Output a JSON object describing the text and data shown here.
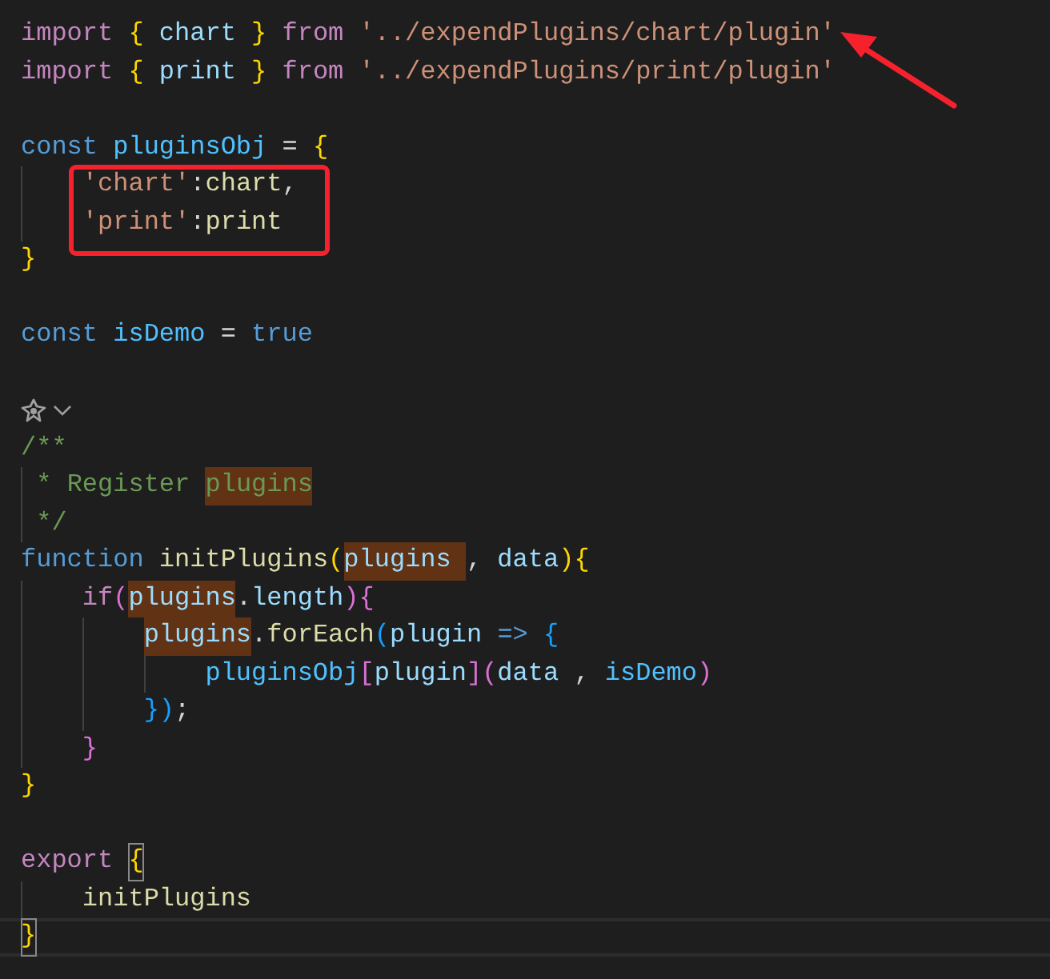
{
  "editor": {
    "lines": [
      {
        "kind": "code",
        "current": false,
        "tokens": [
          {
            "text": "import ",
            "kind": "keyword"
          },
          {
            "text": "{ ",
            "kind": "bracket1"
          },
          {
            "text": "chart ",
            "kind": "variable"
          },
          {
            "text": "} ",
            "kind": "bracket1"
          },
          {
            "text": "from ",
            "kind": "keyword"
          },
          {
            "text": "'../expendPlugins/chart/plugin'",
            "kind": "string"
          }
        ]
      },
      {
        "kind": "code",
        "current": false,
        "tokens": [
          {
            "text": "import ",
            "kind": "keyword"
          },
          {
            "text": "{ ",
            "kind": "bracket1"
          },
          {
            "text": "print ",
            "kind": "variable"
          },
          {
            "text": "} ",
            "kind": "bracket1"
          },
          {
            "text": "from ",
            "kind": "keyword"
          },
          {
            "text": "'../expendPlugins/print/plugin'",
            "kind": "string"
          }
        ]
      },
      {
        "kind": "blank"
      },
      {
        "kind": "code",
        "current": false,
        "tokens": [
          {
            "text": "const ",
            "kind": "storage"
          },
          {
            "text": "pluginsObj",
            "kind": "constant"
          },
          {
            "text": " = ",
            "kind": "plain"
          },
          {
            "text": "{",
            "kind": "bracket1"
          }
        ]
      },
      {
        "kind": "code",
        "current": false,
        "tokens": [
          {
            "text": "    'chart'",
            "kind": "string"
          },
          {
            "text": ":",
            "kind": "plain"
          },
          {
            "text": "chart",
            "kind": "value"
          },
          {
            "text": ",",
            "kind": "plain"
          }
        ]
      },
      {
        "kind": "code",
        "current": false,
        "tokens": [
          {
            "text": "    'print'",
            "kind": "string"
          },
          {
            "text": ":",
            "kind": "plain"
          },
          {
            "text": "print",
            "kind": "value"
          }
        ]
      },
      {
        "kind": "code",
        "current": false,
        "tokens": [
          {
            "text": "}",
            "kind": "bracket1"
          }
        ]
      },
      {
        "kind": "blank"
      },
      {
        "kind": "code",
        "current": false,
        "tokens": [
          {
            "text": "const ",
            "kind": "storage"
          },
          {
            "text": "isDemo",
            "kind": "constant"
          },
          {
            "text": " = ",
            "kind": "plain"
          },
          {
            "text": "true",
            "kind": "storage"
          }
        ]
      },
      {
        "kind": "blank"
      },
      {
        "kind": "codelens"
      },
      {
        "kind": "code",
        "current": false,
        "tokens": [
          {
            "text": "/**",
            "kind": "comment"
          }
        ]
      },
      {
        "kind": "code",
        "current": false,
        "tokens": [
          {
            "text": " * Register ",
            "kind": "comment"
          },
          {
            "text": "plugins",
            "kind": "comment",
            "word_highlight": true
          }
        ]
      },
      {
        "kind": "code",
        "current": false,
        "tokens": [
          {
            "text": " */",
            "kind": "comment"
          }
        ]
      },
      {
        "kind": "code",
        "current": false,
        "tokens": [
          {
            "text": "function ",
            "kind": "storage"
          },
          {
            "text": "initPlugins",
            "kind": "function"
          },
          {
            "text": "(",
            "kind": "bracket1"
          },
          {
            "text": "plugins ",
            "kind": "variable",
            "word_highlight": true
          },
          {
            "text": ", ",
            "kind": "plain"
          },
          {
            "text": "data",
            "kind": "variable"
          },
          {
            "text": ")",
            "kind": "bracket1"
          },
          {
            "text": "{",
            "kind": "bracket1"
          }
        ]
      },
      {
        "kind": "code",
        "current": false,
        "tokens": [
          {
            "text": "    if",
            "kind": "keyword"
          },
          {
            "text": "(",
            "kind": "bracket2"
          },
          {
            "text": "plugins",
            "kind": "variable",
            "word_highlight": true
          },
          {
            "text": ".",
            "kind": "plain"
          },
          {
            "text": "length",
            "kind": "variable"
          },
          {
            "text": ")",
            "kind": "bracket2"
          },
          {
            "text": "{",
            "kind": "bracket2"
          }
        ]
      },
      {
        "kind": "code",
        "current": false,
        "tokens": [
          {
            "text": "        plugins",
            "kind": "variable",
            "word_highlight": true
          },
          {
            "text": ".",
            "kind": "plain"
          },
          {
            "text": "forEach",
            "kind": "function"
          },
          {
            "text": "(",
            "kind": "bracket3"
          },
          {
            "text": "plugin ",
            "kind": "variable"
          },
          {
            "text": "=> ",
            "kind": "storage"
          },
          {
            "text": "{",
            "kind": "bracket3"
          }
        ]
      },
      {
        "kind": "code",
        "current": false,
        "tokens": [
          {
            "text": "            pluginsObj",
            "kind": "constant"
          },
          {
            "text": "[",
            "kind": "bracket2"
          },
          {
            "text": "plugin",
            "kind": "variable"
          },
          {
            "text": "]",
            "kind": "bracket2"
          },
          {
            "text": "(",
            "kind": "bracket2"
          },
          {
            "text": "data ",
            "kind": "variable"
          },
          {
            "text": ", ",
            "kind": "plain"
          },
          {
            "text": "isDemo",
            "kind": "constant"
          },
          {
            "text": ")",
            "kind": "bracket2"
          }
        ]
      },
      {
        "kind": "code",
        "current": false,
        "tokens": [
          {
            "text": "        }",
            "kind": "bracket3"
          },
          {
            "text": ")",
            "kind": "bracket3"
          },
          {
            "text": ";",
            "kind": "plain"
          }
        ]
      },
      {
        "kind": "code",
        "current": false,
        "tokens": [
          {
            "text": "    }",
            "kind": "bracket2"
          }
        ]
      },
      {
        "kind": "code",
        "current": false,
        "tokens": [
          {
            "text": "}",
            "kind": "bracket1"
          }
        ]
      },
      {
        "kind": "blank"
      },
      {
        "kind": "code",
        "current": false,
        "tokens": [
          {
            "text": "export ",
            "kind": "keyword"
          },
          {
            "text": "{",
            "kind": "bracket1",
            "bracket_match": true
          }
        ]
      },
      {
        "kind": "code",
        "current": false,
        "tokens": [
          {
            "text": "    initPlugins",
            "kind": "value"
          }
        ]
      },
      {
        "kind": "code",
        "current": true,
        "tokens": [
          {
            "text": "}",
            "kind": "bracket1",
            "bracket_match": true
          }
        ]
      }
    ]
  }
}
